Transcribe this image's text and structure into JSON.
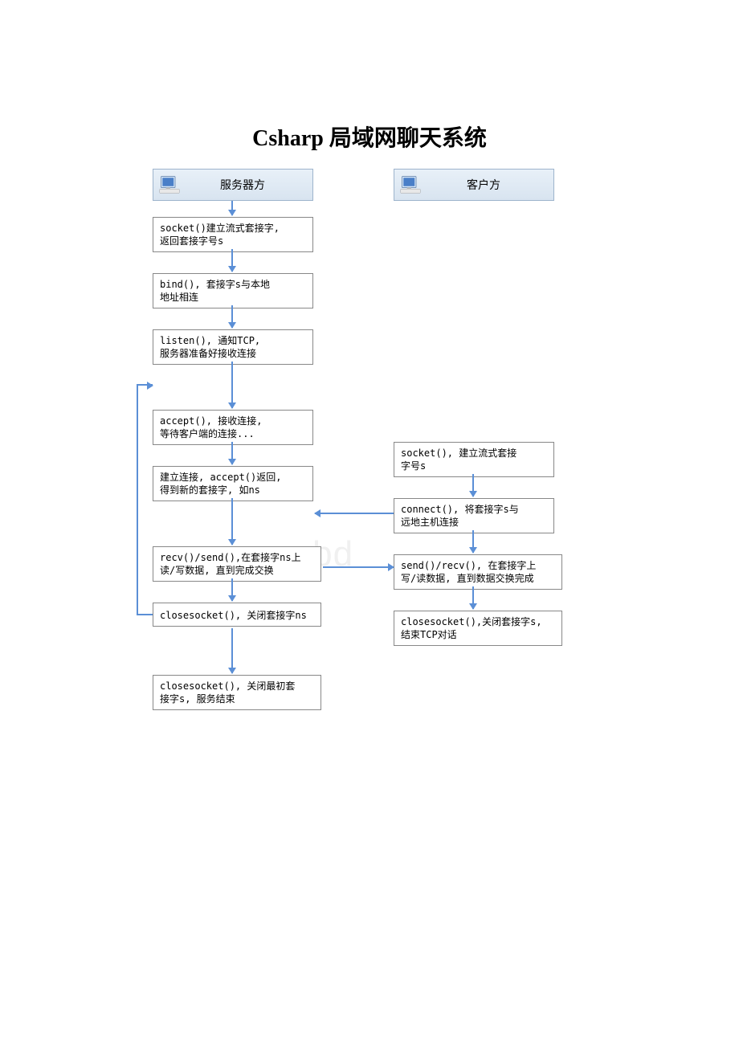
{
  "title": "Csharp 局域网聊天系统",
  "watermark": "www.bd",
  "server": {
    "header": "服务器方",
    "steps": [
      "socket()建立流式套接字,\n返回套接字号s",
      "bind(), 套接字s与本地\n地址相连",
      "listen(), 通知TCP,\n服务器准备好接收连接",
      "accept(), 接收连接,\n等待客户端的连接...",
      "建立连接, accept()返回,\n得到新的套接字, 如ns",
      "recv()/send(),在套接字ns上\n读/写数据, 直到完成交换",
      "closesocket(), 关闭套接字ns",
      "closesocket(), 关闭最初套\n接字s, 服务结束"
    ]
  },
  "client": {
    "header": "客户方",
    "steps": [
      "socket(), 建立流式套接\n字号s",
      "connect(), 将套接字s与\n远地主机连接",
      "send()/recv(), 在套接字上\n写/读数据, 直到数据交换完成",
      "closesocket(),关闭套接字s,\n结束TCP对话"
    ]
  }
}
